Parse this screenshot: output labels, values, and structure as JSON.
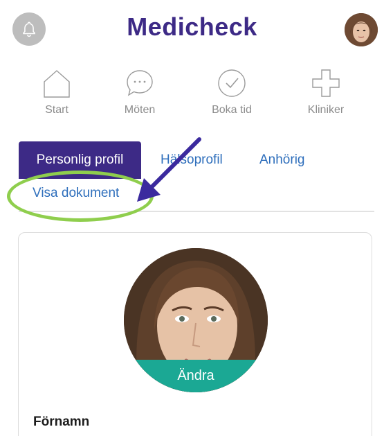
{
  "header": {
    "brand": "Medicheck",
    "bell_icon": "bell-icon",
    "avatar_icon": "user-avatar"
  },
  "nav": {
    "items": [
      {
        "label": "Start",
        "icon": "house-icon"
      },
      {
        "label": "Möten",
        "icon": "chat-bubble-icon"
      },
      {
        "label": "Boka tid",
        "icon": "check-circle-icon"
      },
      {
        "label": "Kliniker",
        "icon": "plus-cross-icon"
      }
    ]
  },
  "tabs": {
    "items": [
      {
        "label": "Personlig profil",
        "active": true
      },
      {
        "label": "Hälsoprofil",
        "active": false
      },
      {
        "label": "Anhörig",
        "active": false
      },
      {
        "label": "Visa dokument",
        "active": false
      }
    ]
  },
  "profile": {
    "change_label": "Ändra",
    "first_name_label": "Förnamn"
  },
  "colors": {
    "brand": "#3d2a86",
    "link": "#2f6fbc",
    "accent": "#1ba894",
    "highlight": "#8fce4d",
    "arrow": "#3b2a9e"
  }
}
